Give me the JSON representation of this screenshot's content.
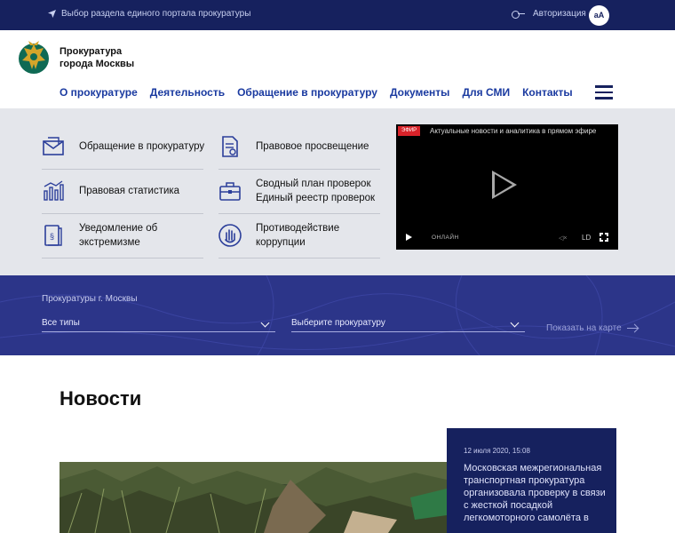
{
  "topbar": {
    "portal_link": "Выбор раздела единого портала прокуратуры",
    "auth_label": "Авторизация",
    "font_size_button": "aA"
  },
  "header": {
    "org_name": "Прокуратура города Москвы",
    "nav": [
      "О прокуратуре",
      "Деятельность",
      "Обращение в прокуратуру",
      "Документы",
      "Для СМИ",
      "Контакты"
    ]
  },
  "services": {
    "items": [
      {
        "label": "Обращение в прокуратуру",
        "icon": "envelope-icon"
      },
      {
        "label": "Правовое просвещение",
        "icon": "document-icon"
      },
      {
        "label": "Правовая статистика",
        "icon": "bar-chart-icon"
      },
      {
        "label": "Сводный план проверок Единый реестр проверок",
        "icon": "briefcase-icon"
      },
      {
        "label": "Уведомление об экстремизме",
        "icon": "book-icon"
      },
      {
        "label": "Противодействие коррупции",
        "icon": "hand-stop-icon"
      }
    ]
  },
  "video": {
    "live_badge": "ЭФИР",
    "title": "Актуальные новости и аналитика в прямом эфире",
    "online_label": "ОНЛАЙН",
    "quality_label": "LD"
  },
  "map": {
    "title": "Прокуратуры г. Москвы",
    "type_select": "Все типы",
    "office_select": "Выберите прокуратуру",
    "show_on_map": "Показать на карте"
  },
  "news": {
    "heading": "Новости",
    "card": {
      "date": "12 июля 2020, 15:08",
      "text": "Московская межрегиональная транспортная прокуратура организовала проверку в связи с жесткой посадкой легкомоторного самолёта в"
    }
  },
  "colors": {
    "navy": "#16215e",
    "map_blue": "#2c3589",
    "nav_link": "#1a3aa0",
    "service_bg": "#e4e6eb"
  }
}
